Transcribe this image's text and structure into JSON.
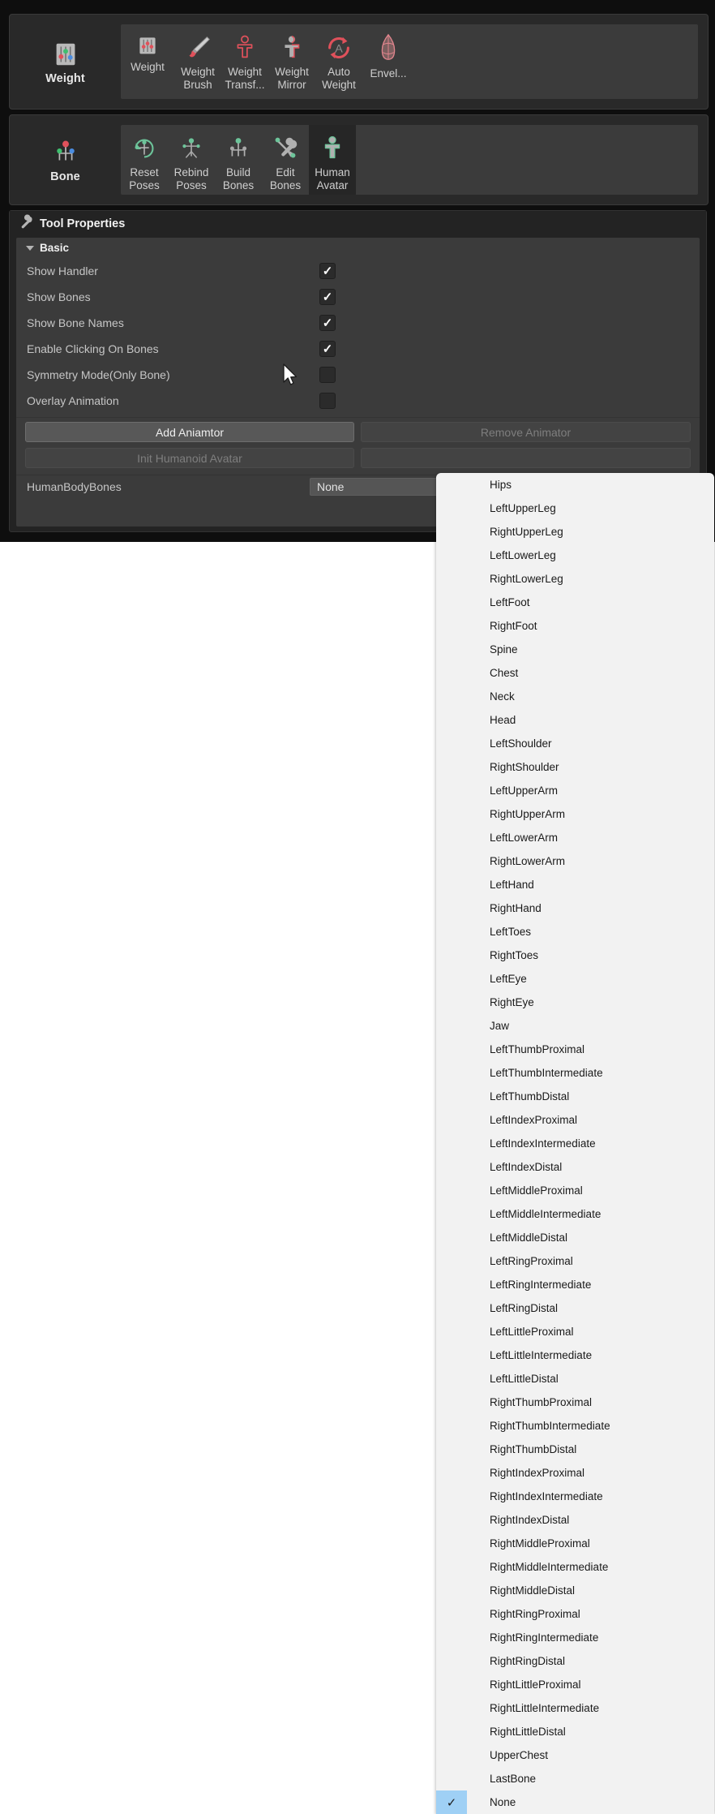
{
  "toolbars": [
    {
      "category": "Weight",
      "category_icon": "weight-sliders-icon",
      "tools": [
        {
          "label": "Weight",
          "icon": "weight-sliders-icon",
          "active": false
        },
        {
          "label": "Weight\nBrush",
          "icon": "paint-brush-icon",
          "active": false
        },
        {
          "label": "Weight\nTransf...",
          "icon": "humanoid-outline-red-icon",
          "active": false
        },
        {
          "label": "Weight\nMirror",
          "icon": "humanoid-mirror-icon",
          "active": false
        },
        {
          "label": "Auto\nWeight",
          "icon": "auto-refresh-a-icon",
          "active": false
        },
        {
          "label": "Envel...",
          "icon": "capsule-envelope-icon",
          "active": false
        }
      ]
    },
    {
      "category": "Bone",
      "category_icon": "bone-joints-icon",
      "tools": [
        {
          "label": "Reset\nPoses",
          "icon": "reset-pose-icon",
          "active": false
        },
        {
          "label": "Rebind\nPoses",
          "icon": "rebind-pose-icon",
          "active": false
        },
        {
          "label": "Build\nBones",
          "icon": "build-bones-icon",
          "active": false
        },
        {
          "label": "Edit\nBones",
          "icon": "wrench-screwdriver-icon",
          "active": false
        },
        {
          "label": "Human\nAvatar",
          "icon": "human-avatar-icon",
          "active": true
        }
      ]
    }
  ],
  "tool_properties": {
    "title": "Tool Properties",
    "title_icon": "wrench-icon",
    "section": {
      "label": "Basic",
      "expanded": true,
      "toggles": [
        {
          "label": "Show Handler",
          "checked": true
        },
        {
          "label": "Show Bones",
          "checked": true
        },
        {
          "label": "Show Bone Names",
          "checked": true
        },
        {
          "label": "Enable Clicking On Bones",
          "checked": true
        },
        {
          "label": "Symmetry Mode(Only Bone)",
          "checked": false
        },
        {
          "label": "Overlay Animation",
          "checked": false
        }
      ]
    },
    "buttons": [
      {
        "label": "Add Aniamtor",
        "enabled": true,
        "side": "left"
      },
      {
        "label": "Remove Animator",
        "enabled": false,
        "side": "right"
      },
      {
        "label": "Init Humanoid Avatar",
        "enabled": false,
        "side": "left"
      },
      {
        "label": "",
        "enabled": false,
        "side": "right"
      }
    ],
    "field": {
      "label": "HumanBodyBones",
      "value": "None",
      "caret_icon": "chevron-down-icon"
    }
  },
  "dropdown": {
    "selected": "None",
    "check_icon": "check-icon",
    "items": [
      "Hips",
      "LeftUpperLeg",
      "RightUpperLeg",
      "LeftLowerLeg",
      "RightLowerLeg",
      "LeftFoot",
      "RightFoot",
      "Spine",
      "Chest",
      "Neck",
      "Head",
      "LeftShoulder",
      "RightShoulder",
      "LeftUpperArm",
      "RightUpperArm",
      "LeftLowerArm",
      "RightLowerArm",
      "LeftHand",
      "RightHand",
      "LeftToes",
      "RightToes",
      "LeftEye",
      "RightEye",
      "Jaw",
      "LeftThumbProximal",
      "LeftThumbIntermediate",
      "LeftThumbDistal",
      "LeftIndexProximal",
      "LeftIndexIntermediate",
      "LeftIndexDistal",
      "LeftMiddleProximal",
      "LeftMiddleIntermediate",
      "LeftMiddleDistal",
      "LeftRingProximal",
      "LeftRingIntermediate",
      "LeftRingDistal",
      "LeftLittleProximal",
      "LeftLittleIntermediate",
      "LeftLittleDistal",
      "RightThumbProximal",
      "RightThumbIntermediate",
      "RightThumbDistal",
      "RightIndexProximal",
      "RightIndexIntermediate",
      "RightIndexDistal",
      "RightMiddleProximal",
      "RightMiddleIntermediate",
      "RightMiddleDistal",
      "RightRingProximal",
      "RightRingIntermediate",
      "RightRingDistal",
      "RightLittleProximal",
      "RightLittleIntermediate",
      "RightLittleDistal",
      "UpperChest",
      "LastBone",
      "None"
    ]
  },
  "cursor": {
    "icon": "mouse-pointer-icon"
  },
  "colors": {
    "panel_bg": "#232323",
    "tray_bg": "#3b3b3b",
    "accent_red": "#e0515b",
    "accent_green": "#6dc49a",
    "selection_blue": "#9fd0f5"
  }
}
